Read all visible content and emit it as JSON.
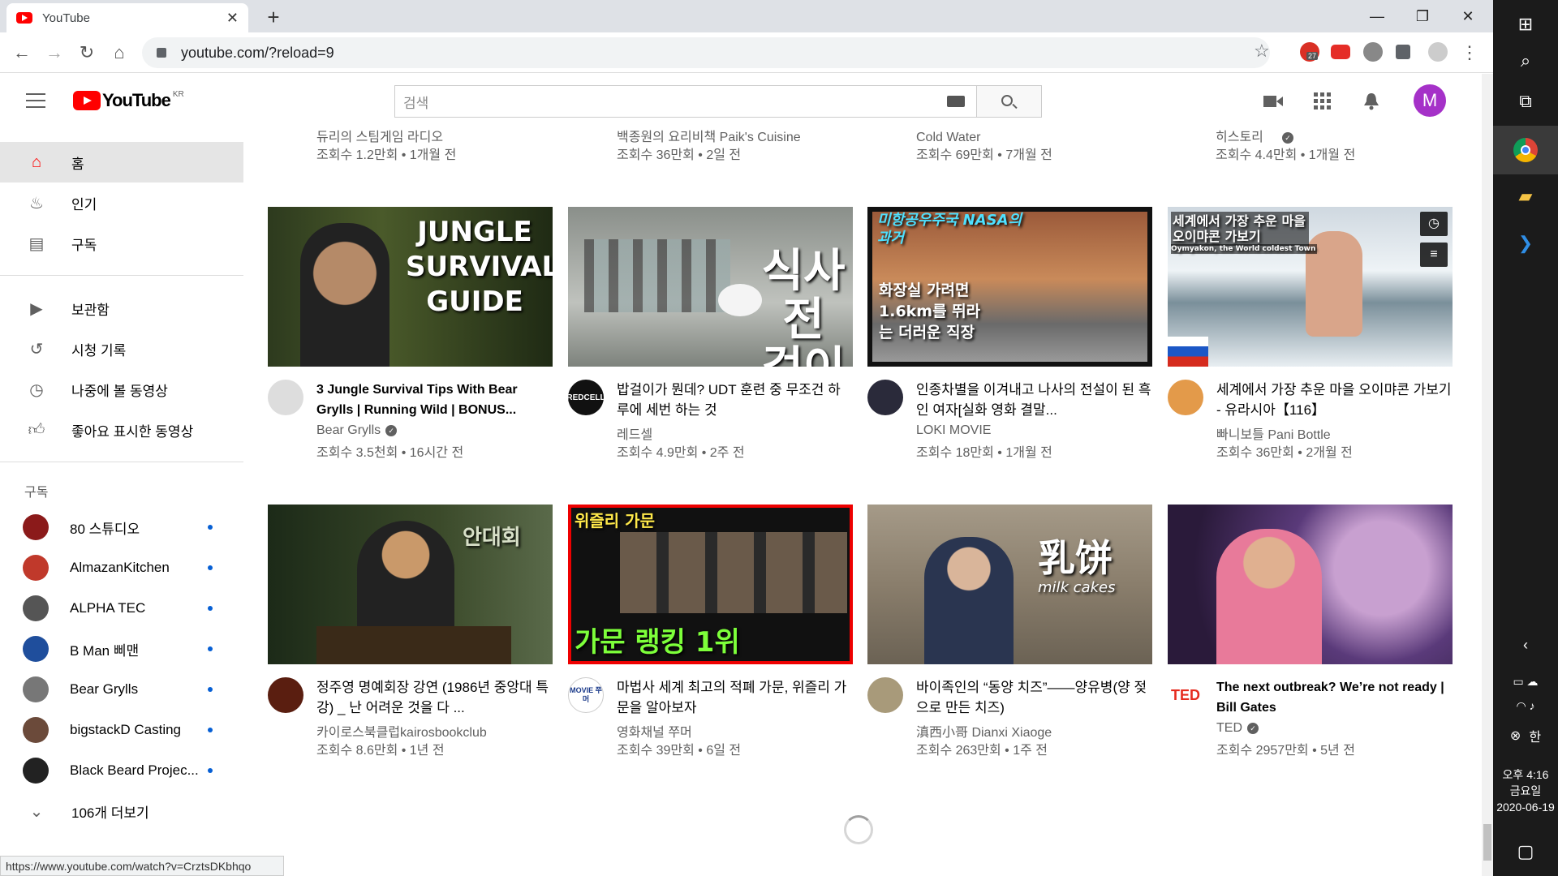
{
  "browser": {
    "tab_title": "YouTube",
    "url": "youtube.com/?reload=9",
    "status_url": "https://www.youtube.com/watch?v=CrztsDKbhqo",
    "ext_badge": "27"
  },
  "youtube": {
    "region": "KR",
    "search_placeholder": "검색",
    "avatar_letter": "M"
  },
  "sidebar": {
    "main": [
      {
        "label": "홈",
        "icon": "home-icon"
      },
      {
        "label": "인기",
        "icon": "fire-icon"
      },
      {
        "label": "구독",
        "icon": "subscriptions-icon"
      }
    ],
    "library": [
      {
        "label": "보관함",
        "icon": "library-icon"
      },
      {
        "label": "시청 기록",
        "icon": "history-icon"
      },
      {
        "label": "나중에 볼 동영상",
        "icon": "clock-icon"
      },
      {
        "label": "좋아요 표시한 동영상",
        "icon": "thumbs-up-icon"
      }
    ],
    "subs_heading": "구독",
    "subs": [
      {
        "label": "80 스튜디오",
        "color": "#8b1a1a"
      },
      {
        "label": "AlmazanKitchen",
        "color": "#c0392b"
      },
      {
        "label": "ALPHA TEC",
        "color": "#555555"
      },
      {
        "label": "B Man 삐맨",
        "color": "#1f4e9c"
      },
      {
        "label": "Bear Grylls",
        "color": "#777777"
      },
      {
        "label": "bigstackD Casting",
        "color": "#6b4a3a"
      },
      {
        "label": "Black Beard Projec...",
        "color": "#222222"
      }
    ],
    "more": "106개 더보기"
  },
  "top_row": [
    {
      "channel": "듀리의 스팀게임 라디오",
      "stats": "조회수 1.2만회 • 1개월 전"
    },
    {
      "channel": "백종원의 요리비책 Paik's Cuisine",
      "stats": "조회수 36만회 • 2일 전"
    },
    {
      "channel": "Cold Water",
      "stats": "조회수 69만회 • 7개월 전"
    },
    {
      "channel": "히스토리",
      "stats": "조회수 4.4만회 • 1개월 전"
    }
  ],
  "videos": [
    {
      "title": "3 Jungle Survival Tips With Bear Grylls | Running Wild | BONUS...",
      "channel": "Bear Grylls",
      "verified": true,
      "stats": "조회수 3.5천회 • 16시간 전",
      "thumb_text": "JUNGLE SURVIVAL GUIDE"
    },
    {
      "title": "밥걸이가 뭔데? UDT 훈련 중 무조건 하루에 세번 하는 것",
      "channel": "레드셀",
      "verified": false,
      "stats": "조회수 4.9만회 • 2주 전",
      "thumb_text": "식사 전 걸이",
      "avatar_text": "REDCELL"
    },
    {
      "title": "인종차별을 이겨내고 나사의 전설이 된 흑인 여자[실화 영화 결말...",
      "channel": "LOKI MOVIE",
      "verified": false,
      "stats": "조회수 18만회 • 1개월 전",
      "thumb_text": "미항공우주국 NASA의 과거",
      "thumb_text2": "화장실 가려면 1.6km를 뛰라는 더러운 직장"
    },
    {
      "title": "세계에서 가장 추운 마을 오이먀콘 가보기 - 유라시아【116】",
      "channel": "빠니보틀 Pani Bottle",
      "verified": false,
      "stats": "조회수 36만회 • 2개월 전",
      "thumb_text": "세계에서 가장 추운 마을 오이먀콘 가보기",
      "thumb_text2": "Oymyakon, the World coldest Town"
    },
    {
      "title": "정주영 명예회장 강연 (1986년 중앙대 특강) _ 난 어려운 것을 다 ...",
      "channel": "카이로스북클럽kairosbookclub",
      "verified": false,
      "stats": "조회수 8.6만회 • 1년 전",
      "thumb_text": "안대회"
    },
    {
      "title": "마법사 세계 최고의 적폐 가문, 위즐리 가문을 알아보자",
      "channel": "영화채널 쭈머",
      "verified": false,
      "stats": "조회수 39만회 • 6일 전",
      "thumb_text": "위즐리 가문",
      "thumb_text2": "가문 랭킹 1위",
      "avatar_text": "MOVIE 쭈머"
    },
    {
      "title": "바이족인의 “동양 치즈”——양유병(양 젖으로 만든 치즈)",
      "channel": "滇西小哥 Dianxi Xiaoge",
      "verified": false,
      "stats": "조회수 263만회 • 1주 전",
      "thumb_text": "乳饼",
      "thumb_text2": "milk cakes"
    },
    {
      "title": "The next outbreak? We’re not ready | Bill Gates",
      "channel": "TED",
      "verified": true,
      "stats": "조회수 2957만회 • 5년 전",
      "avatar_text": "TED"
    }
  ],
  "taskbar": {
    "time": "오후 4:16",
    "day": "금요일",
    "date": "2020-06-19",
    "ime": "한"
  }
}
